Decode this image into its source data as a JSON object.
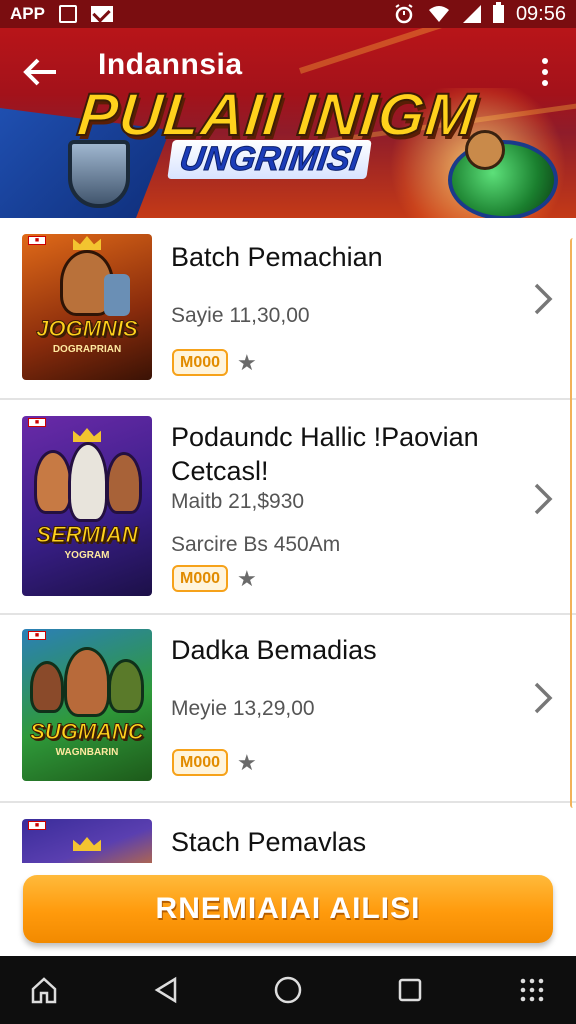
{
  "status_bar": {
    "app_label": "APP",
    "time": "09:56"
  },
  "header": {
    "country": "Indannsia",
    "banner_title": "PULAII INIGM",
    "banner_subtitle": "UNGRIMISI"
  },
  "list": {
    "items": [
      {
        "title": "Batch Pemachian",
        "meta": [
          "Sayie 11,30,00"
        ],
        "price_badge": "M000",
        "thumb_label": "JOGMNIS",
        "thumb_sub": "DOGRAPRIAN",
        "colors": [
          "#c24a12",
          "#f08a1c"
        ]
      },
      {
        "title": "Podaundc Hallic !Paovian Cetcasl!",
        "meta": [
          "Maitb 21,$930",
          "Sarcire Bs 450Am"
        ],
        "price_badge": "M000",
        "thumb_label": "SERMIAN",
        "thumb_sub": "YOGRAM",
        "colors": [
          "#5a1f8e",
          "#2c1b6b"
        ]
      },
      {
        "title": "Dadka Bemadias",
        "meta": [
          "Meyie 13,29,00"
        ],
        "price_badge": "M000",
        "thumb_label": "SUGMANC",
        "thumb_sub": "WAGNBARIN",
        "colors": [
          "#2a8a2c",
          "#1f5d8e"
        ]
      },
      {
        "title": "Stach Pemavlas",
        "meta": [],
        "price_badge": "",
        "thumb_label": "",
        "thumb_sub": "",
        "colors": [
          "#3a2c9a",
          "#d97a20"
        ]
      }
    ]
  },
  "cta": {
    "label": "RNEMIAIAI AILISI"
  },
  "icons": {
    "back": "back-arrow-icon",
    "more": "more-vertical-icon",
    "star": "star-icon",
    "chevron": "chevron-right-icon",
    "nav": [
      "home-icon",
      "back-triangle-icon",
      "circle-home-icon",
      "square-recents-icon",
      "grid-apps-icon"
    ]
  },
  "theme": {
    "header_red": "#b81519",
    "accent_orange": "#ff9a0c",
    "badge_orange": "#f6a21a"
  }
}
